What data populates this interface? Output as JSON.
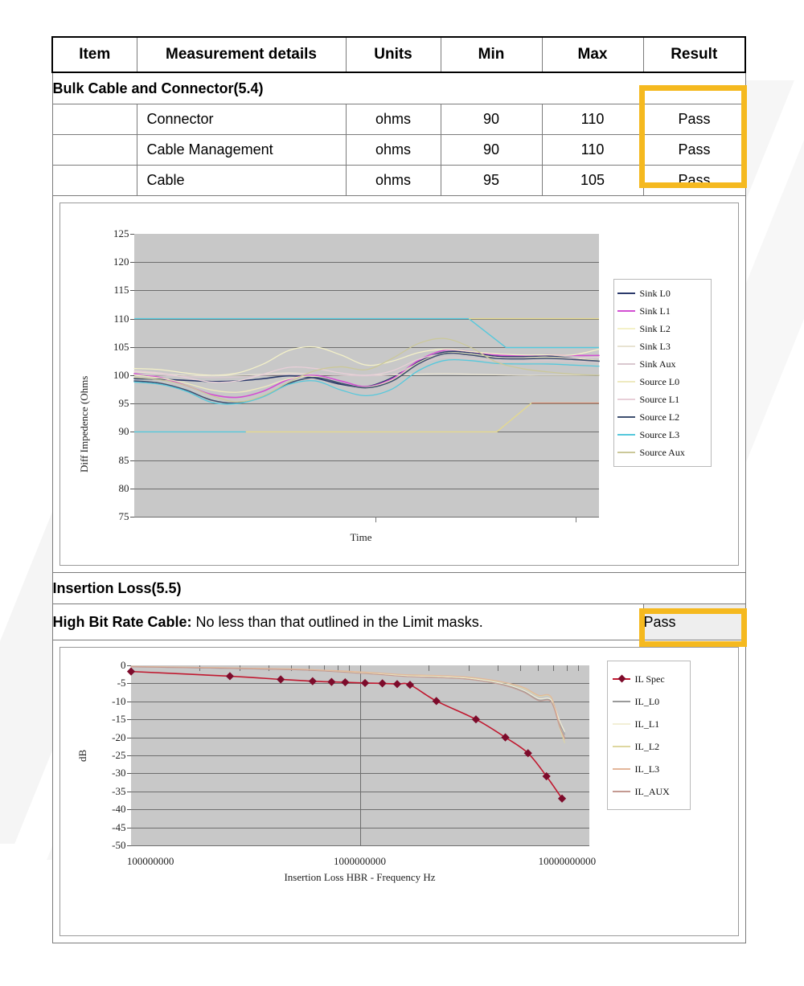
{
  "table": {
    "headers": [
      "Item",
      "Measurement details",
      "Units",
      "Min",
      "Max",
      "Result"
    ],
    "sections": [
      {
        "title": "Bulk Cable and Connector(5.4)",
        "rows": [
          {
            "item": "",
            "details": "Connector",
            "units": "ohms",
            "min": "90",
            "max": "110",
            "result": "Pass"
          },
          {
            "item": "",
            "details": "Cable Management",
            "units": "ohms",
            "min": "90",
            "max": "110",
            "result": "Pass"
          },
          {
            "item": "",
            "details": "Cable",
            "units": "ohms",
            "min": "95",
            "max": "105",
            "result": "Pass"
          }
        ]
      },
      {
        "title": "Insertion Loss(5.5)",
        "note_label": "High Bit Rate Cable:",
        "note_text": " No less than that outlined in the Limit masks.",
        "note_result": "Pass"
      }
    ]
  },
  "highlight_color": "#f5b91f",
  "chart_data": [
    {
      "type": "line",
      "title": "",
      "xlabel": "Time",
      "ylabel": "Diff Impedence (Ohms",
      "ylim": [
        75,
        125
      ],
      "yticks": [
        125,
        120,
        115,
        110,
        105,
        100,
        95,
        90,
        85,
        80,
        75
      ],
      "grid": true,
      "legend_position": "right",
      "legend": [
        "Sink L0",
        "Sink L1",
        "Sink L2",
        "Sink L3",
        "Sink Aux",
        "Source L0",
        "Source L1",
        "Source L2",
        "Source L3",
        "Source Aux"
      ],
      "colors": [
        "#2b3a6b",
        "#d24fd2",
        "#f4f1c8",
        "#e8e3d2",
        "#d9c8cf",
        "#eeeac0",
        "#e8cfd8",
        "#3f5070",
        "#55c8dc",
        "#cbc899"
      ],
      "series": [
        {
          "name": "Sink L0",
          "values": [
            99.4,
            99.3,
            99.1,
            98.9,
            99.0,
            99.4,
            99.9,
            99.5,
            98.4,
            98.0,
            99.6,
            102.4,
            104.1,
            104.0,
            103.4,
            103.3,
            103.4,
            103.0,
            102.5
          ]
        },
        {
          "name": "Sink L1",
          "values": [
            100.3,
            99.6,
            98.2,
            96.6,
            96.1,
            97.2,
            99.3,
            100.0,
            99.0,
            98.0,
            99.4,
            102.6,
            104.4,
            104.2,
            103.6,
            103.5,
            103.6,
            103.5,
            103.5
          ]
        },
        {
          "name": "Sink L2",
          "values": [
            101.2,
            101.0,
            100.4,
            100.0,
            100.4,
            102.0,
            104.4,
            105.0,
            103.6,
            101.8,
            102.5,
            104.0,
            104.6,
            104.2,
            103.8,
            103.6,
            103.6,
            103.6,
            104.6
          ]
        },
        {
          "name": "Sink L3",
          "values": [
            100.6,
            100.3,
            100.0,
            99.9,
            100.0,
            100.2,
            100.4,
            100.2,
            100.0,
            100.0,
            100.1,
            100.2,
            100.3,
            100.2,
            100.1,
            100.0,
            100.0,
            100.0,
            100.0
          ]
        },
        {
          "name": "Sink Aux",
          "values": [
            100.1,
            100.0,
            99.8,
            99.6,
            99.7,
            100.0,
            100.2,
            100.2,
            100.0,
            99.9,
            100.2,
            102.0,
            103.2,
            103.0,
            102.6,
            102.5,
            102.6,
            102.5,
            102.4
          ]
        },
        {
          "name": "Source L0",
          "values": [
            100.0,
            99.5,
            98.6,
            97.4,
            97.0,
            97.9,
            99.4,
            99.8,
            98.6,
            97.9,
            99.2,
            102.2,
            103.9,
            103.8,
            103.2,
            103.1,
            103.2,
            103.0,
            102.6
          ]
        },
        {
          "name": "Source L1",
          "values": [
            100.8,
            100.4,
            99.6,
            98.8,
            99.0,
            100.2,
            101.4,
            101.2,
            100.4,
            100.0,
            100.8,
            102.8,
            103.8,
            103.5,
            103.1,
            103.0,
            103.0,
            103.0,
            103.2
          ]
        },
        {
          "name": "Source L2",
          "values": [
            99.0,
            98.6,
            97.4,
            95.6,
            95.1,
            96.3,
            98.6,
            99.6,
            98.6,
            97.8,
            99.0,
            102.0,
            103.8,
            103.6,
            103.0,
            102.9,
            103.0,
            102.8,
            102.5
          ]
        },
        {
          "name": "Source L3",
          "values": [
            98.8,
            98.4,
            97.2,
            95.2,
            95.0,
            96.2,
            98.4,
            99.0,
            97.4,
            96.4,
            97.6,
            100.8,
            102.6,
            102.6,
            102.1,
            102.0,
            102.0,
            101.8,
            101.6
          ]
        },
        {
          "name": "Source Aux",
          "values": [
            99.6,
            99.2,
            98.2,
            96.4,
            95.3,
            96.4,
            98.8,
            100.8,
            101.5,
            101.0,
            103.0,
            105.6,
            106.5,
            105.0,
            102.4,
            101.2,
            100.6,
            100.2,
            100.0
          ]
        }
      ],
      "limit_lines": [
        {
          "name": "upper-limit",
          "value": 110,
          "color": "#55c8dc"
        },
        {
          "name": "lower-limit",
          "value": 90,
          "color": "#55c8dc"
        }
      ]
    },
    {
      "type": "line",
      "title": "",
      "xlabel": "Insertion Loss  HBR - Frequency Hz",
      "ylabel": "dB",
      "ylim": [
        -50,
        0
      ],
      "yticks": [
        0,
        -5,
        -10,
        -15,
        -20,
        -25,
        -30,
        -35,
        -40,
        -45,
        -50
      ],
      "xticks": [
        "100000000",
        "1000000000",
        "10000000000"
      ],
      "xscale": "log",
      "grid": true,
      "legend_position": "right",
      "legend": [
        "IL Spec",
        "IL_L0",
        "IL_L1",
        "IL_L2",
        "IL_L3",
        "IL_AUX"
      ],
      "colors": [
        "#c0182f",
        "#9a9a9a",
        "#f2efd6",
        "#ded7a0",
        "#e3b69a",
        "#c49a92"
      ],
      "series": [
        {
          "name": "IL Spec",
          "x": [
            100000000.0,
            270000000.0,
            450000000.0,
            620000000.0,
            750000000.0,
            860000000.0,
            1050000000.0,
            1250000000.0,
            1450000000.0,
            1650000000.0,
            2150000000.0,
            3200000000.0,
            4300000000.0,
            5400000000.0,
            6500000000.0,
            7600000000.0
          ],
          "y": [
            -1.7,
            -3.0,
            -3.9,
            -4.4,
            -4.6,
            -4.7,
            -4.9,
            -5.0,
            -5.2,
            -5.4,
            -9.9,
            -15.0,
            -20.0,
            -24.4,
            -30.8,
            -37.0
          ],
          "marker": "diamond"
        },
        {
          "name": "IL_L0",
          "x": [
            100000000.0,
            500000000.0,
            1000000000.0,
            1600000000.0,
            2200000000.0,
            2900000000.0,
            3600000000.0,
            4400000000.0,
            5200000000.0,
            6000000000.0,
            6800000000.0,
            7400000000.0,
            7800000000.0
          ],
          "y": [
            -0.4,
            -1.2,
            -2.1,
            -3.0,
            -3.2,
            -3.6,
            -4.4,
            -5.6,
            -7.3,
            -9.6,
            -9.9,
            -16.0,
            -19.2
          ]
        },
        {
          "name": "IL_L1",
          "x": [
            100000000.0,
            500000000.0,
            1000000000.0,
            1600000000.0,
            2200000000.0,
            2900000000.0,
            3600000000.0,
            4400000000.0,
            5200000000.0,
            6000000000.0,
            6800000000.0,
            7400000000.0,
            7800000000.0
          ],
          "y": [
            -0.4,
            -1.1,
            -2.0,
            -2.9,
            -3.1,
            -3.5,
            -4.3,
            -5.4,
            -7.0,
            -9.2,
            -9.5,
            -15.2,
            -18.4
          ]
        },
        {
          "name": "IL_L2",
          "x": [
            100000000.0,
            500000000.0,
            1000000000.0,
            1600000000.0,
            2200000000.0,
            2900000000.0,
            3600000000.0,
            4400000000.0,
            5200000000.0,
            6000000000.0,
            6800000000.0,
            7400000000.0,
            7800000000.0
          ],
          "y": [
            -0.3,
            -1.0,
            -1.9,
            -2.7,
            -2.9,
            -3.3,
            -4.0,
            -5.0,
            -6.4,
            -8.5,
            -8.9,
            -17.0,
            -21.5
          ]
        },
        {
          "name": "IL_L3",
          "x": [
            100000000.0,
            500000000.0,
            1000000000.0,
            1600000000.0,
            2200000000.0,
            2900000000.0,
            3600000000.0,
            4400000000.0,
            5200000000.0,
            6000000000.0,
            6800000000.0,
            7400000000.0,
            7800000000.0
          ],
          "y": [
            -0.3,
            -1.0,
            -1.8,
            -2.6,
            -2.8,
            -3.2,
            -3.9,
            -4.9,
            -6.2,
            -8.3,
            -8.7,
            -16.4,
            -20.6
          ]
        },
        {
          "name": "IL_AUX",
          "x": [
            100000000.0,
            500000000.0,
            1000000000.0,
            1600000000.0,
            2200000000.0,
            2900000000.0,
            3600000000.0,
            4400000000.0,
            5200000000.0,
            6000000000.0,
            6800000000.0,
            7400000000.0,
            7800000000.0
          ],
          "y": [
            -0.4,
            -1.2,
            -2.2,
            -3.1,
            -3.4,
            -3.8,
            -4.6,
            -5.8,
            -7.5,
            -9.8,
            -10.1,
            -16.8,
            -20.0
          ]
        }
      ]
    }
  ]
}
